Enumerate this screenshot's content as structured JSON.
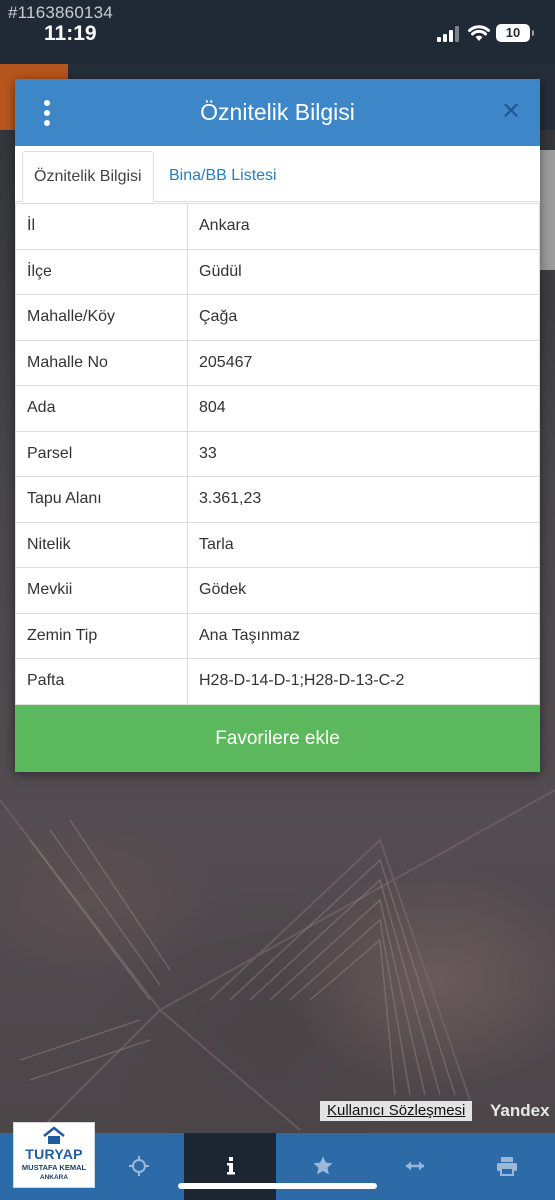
{
  "status_bar": {
    "watermark_id": "#1163860134",
    "time": "11:19",
    "battery": "10"
  },
  "modal": {
    "title": "Öznitelik Bilgisi",
    "tabs": [
      {
        "label": "Öznitelik Bilgisi",
        "active": true
      },
      {
        "label": "Bina/BB Listesi",
        "active": false
      }
    ],
    "rows": [
      {
        "key": "İl",
        "value": "Ankara"
      },
      {
        "key": "İlçe",
        "value": "Güdül"
      },
      {
        "key": "Mahalle/Köy",
        "value": "Çağa"
      },
      {
        "key": "Mahalle No",
        "value": "205467"
      },
      {
        "key": "Ada",
        "value": "804"
      },
      {
        "key": "Parsel",
        "value": "33"
      },
      {
        "key": "Tapu Alanı",
        "value": "3.361,23"
      },
      {
        "key": "Nitelik",
        "value": "Tarla"
      },
      {
        "key": "Mevkii",
        "value": "Gödek"
      },
      {
        "key": "Zemin Tip",
        "value": "Ana Taşınmaz"
      },
      {
        "key": "Pafta",
        "value": "H28-D-14-D-1;H28-D-13-C-2"
      }
    ],
    "favorite_button": "Favorilere ekle"
  },
  "map": {
    "terms_link": "Kullanıcı Sözleşmesi",
    "provider": "Yandex"
  },
  "toolbar": {
    "logo_name": "TURYAP",
    "logo_sub": "MUSTAFA KEMAL",
    "logo_city": "ANKARA",
    "buttons": [
      {
        "icon": "crosshair-icon"
      },
      {
        "icon": "info-icon",
        "active": true
      },
      {
        "icon": "star-icon"
      },
      {
        "icon": "measure-icon"
      },
      {
        "icon": "print-icon"
      }
    ]
  },
  "colors": {
    "header_blue": "#3d87c8",
    "favorite_green": "#5cb85c",
    "toolbar_blue": "#2d6aa8",
    "toolbar_active": "#1c2633"
  }
}
